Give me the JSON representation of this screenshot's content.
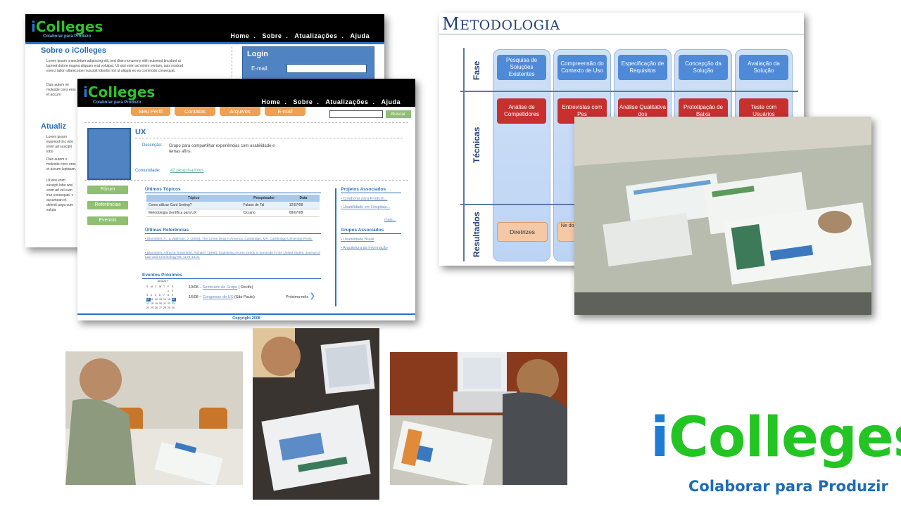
{
  "shot1": {
    "logo_i": "i",
    "logo_rest": "Colleges",
    "tagline": "Colaborar para Produzir",
    "nav": [
      "Home",
      ".",
      "Sobre",
      ".",
      "Atualizações",
      ".",
      "Ajuda"
    ],
    "title_sobre": "Sobre o iColleges",
    "p1": "Lorem ipsum onsectetuer adipiscing elit, sed diam nonummy nibh euismod tincidunt ut laoreet dolore magna aliquam erat volutpat. Ut wisi enim ad minim veniam, quis nostrud exerci tation ullamcorper suscipit lobortis nisl ut aliquip ex ea commodo consequat.",
    "p2": "Duis autem ve molestie cons eros et accum",
    "login_title": "Login",
    "login_email_label": "E-mail",
    "title_atual": "Atualiz",
    "p3": "Lorem ipsum euismod tinc wisi enim ad suscipit lobo",
    "p4": "Duis autem v molestie cons eros et accum luptatum.",
    "p5": "Ut wisi enim suscipit lobo wisi enim ad vel eum iriur consequat, v accumsan et delenit augu cum soluta"
  },
  "shot2": {
    "logo_i": "i",
    "logo_rest": "Colleges",
    "tagline": "Colaborar para Produzir",
    "nav": [
      "Home",
      ".",
      "Sobre",
      ".",
      "Atualizações",
      ".",
      "Ajuda"
    ],
    "tabs": [
      "Meu Perfil",
      "Contatos",
      "Arquivos",
      "E-mail"
    ],
    "search_btn": "Buscar",
    "group_title": "UX",
    "desc_label": "Descrição:",
    "desc_text": "Grupo para compartilhar experiências com usabilidade e temas afins.",
    "community_label": "Comunidade:",
    "community_value": "42 pesquisadores",
    "side_buttons": [
      "Fórum",
      "Referências",
      "Eventos"
    ],
    "topics_title": "Últimos Tópicos",
    "topics_headers": [
      "Tópico",
      "Pesquisador",
      "Data"
    ],
    "topics_rows": [
      [
        "Como utilizar Card Sorting?",
        "Fulano de Tal",
        "12/07/08"
      ],
      [
        "Metodologia científica para UX",
        "Cicrano",
        "08/07/08"
      ]
    ],
    "refs_title": "Últimas Referências",
    "ref1": "• Blumstein, A., & Wallman, J. (2000). The Crime Drop in America. Cambridge, MA: Cambridge University Press.",
    "ref2": "• Blumstein, Alfred & Rosenfeld, Richard. (1998). Explaining recent trends in homicide in the United States. Journal of Law and Criminology 88, 1175-1216.",
    "events_title": "Eventos Próximos",
    "cal_month": "AUGUST",
    "cal_days": [
      "S",
      "M",
      "T",
      "W",
      "T",
      "F",
      "S",
      "",
      "",
      "",
      "",
      "",
      "1",
      "2",
      "3",
      "4",
      "5",
      "6",
      "7",
      "8",
      "9",
      "10",
      "11",
      "12",
      "13",
      "14",
      "15",
      "16",
      "17",
      "18",
      "19",
      "20",
      "21",
      "22",
      "23",
      "24",
      "25",
      "26",
      "27",
      "28",
      "29",
      "30"
    ],
    "event1_date": "10/08 –",
    "event1_link": "Seminário do Grupo",
    "event1_loc": "( Recife)",
    "event2_date": "16/08 –",
    "event2_link": "Congresso de UX",
    "event2_loc": "(São Paulo)",
    "next_month": "Próximo mês",
    "projects_title": "Projetos Associados",
    "projects": [
      "• Colaborar para Produzir...",
      "• Usabilidade em Hospitais..."
    ],
    "more": "mais...",
    "groups_title": "Grupos Associados",
    "groups": [
      "• Usabilidade Brasil",
      "• Arquitetura da Informação"
    ],
    "footer": "Copyright 2008"
  },
  "meto": {
    "title_first": "M",
    "title_rest": "ETODOLOGIA",
    "row_fase": "Fase",
    "row_tecnicas": "Técnicas",
    "row_resultados": "Resultados",
    "fases": [
      "Pesquisa de Soluções Existentes",
      "Compreensão do Contexto de Uso",
      "Especificação de Requisitos",
      "Concepção da Solução",
      "Avaliação da Solução"
    ],
    "tecnicas": [
      "Análise de Competidores",
      "Entrevistas com Pes",
      "Análise Qualitativa dos",
      "Prototipação de Baixa",
      "Teste com Usuários"
    ],
    "resultados": [
      "Diretrizes",
      "Ne dos"
    ]
  },
  "brand": {
    "logo_i": "i",
    "logo_rest": "Colleges",
    "tagline": "Colaborar para Produzir",
    "colors": {
      "green": "#22c522",
      "blue": "#1e7cd4"
    }
  }
}
